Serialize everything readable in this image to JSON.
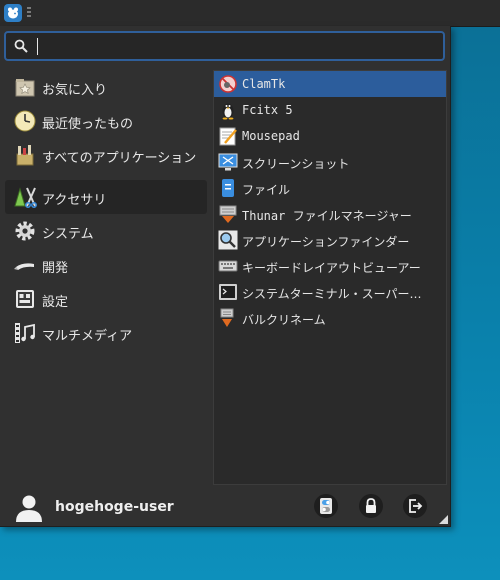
{
  "search": {
    "value": "",
    "placeholder": ""
  },
  "categories": [
    {
      "label": "お気に入り",
      "icon": "favorites-icon"
    },
    {
      "label": "最近使ったもの",
      "icon": "recent-clock-icon"
    },
    {
      "label": "すべてのアプリケーション",
      "icon": "all-applications-icon"
    },
    {
      "label": "アクセサリ",
      "icon": "accessories-icon",
      "active": true
    },
    {
      "label": "システム",
      "icon": "system-gear-icon"
    },
    {
      "label": "開発",
      "icon": "development-icon"
    },
    {
      "label": "設定",
      "icon": "settings-icon"
    },
    {
      "label": "マルチメディア",
      "icon": "multimedia-icon"
    }
  ],
  "apps": [
    {
      "label": "ClamTk",
      "icon": "clamtk-icon",
      "selected": true
    },
    {
      "label": "Fcitx 5",
      "icon": "penguin-icon"
    },
    {
      "label": "Mousepad",
      "icon": "text-editor-icon"
    },
    {
      "label": "スクリーンショット",
      "icon": "screenshot-icon"
    },
    {
      "label": "ファイル",
      "icon": "file-icon"
    },
    {
      "label": "Thunar ファイルマネージャー",
      "icon": "thunar-icon"
    },
    {
      "label": "アプリケーションファインダー",
      "icon": "magnifier-icon"
    },
    {
      "label": "キーボードレイアウトビューアー",
      "icon": "keyboard-icon"
    },
    {
      "label": "システムターミナル・スーパー…",
      "icon": "terminal-icon"
    },
    {
      "label": "バルクリネーム",
      "icon": "bulk-rename-icon"
    }
  ],
  "user": {
    "name": "hogehoge-user"
  },
  "actions": [
    {
      "icon": "settings-toggle-icon"
    },
    {
      "icon": "lock-icon"
    },
    {
      "icon": "logout-icon"
    }
  ],
  "colors": {
    "selection": "#2c5d9c",
    "search_border": "#2f5f9a",
    "panel": "#303030"
  }
}
